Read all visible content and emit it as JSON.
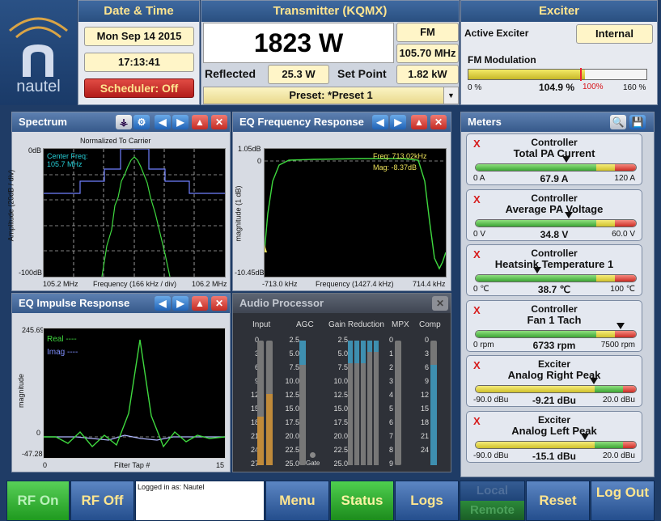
{
  "branding": {
    "logo_text": "nautel"
  },
  "datetime": {
    "title": "Date & Time",
    "date": "Mon Sep 14 2015",
    "time": "17:13:41",
    "scheduler": "Scheduler: Off"
  },
  "transmitter": {
    "title": "Transmitter (KQMX)",
    "power": "1823 W",
    "mode": "FM",
    "frequency": "105.70 MHz",
    "reflected_label": "Reflected",
    "reflected_value": "25.3 W",
    "setpoint_label": "Set Point",
    "setpoint_value": "1.82 kW",
    "preset": "Preset: *Preset 1"
  },
  "exciter": {
    "title": "Exciter",
    "active_label": "Active Exciter",
    "active_value": "Internal",
    "mod_label": "FM Modulation",
    "mod_min": "0 %",
    "mod_value": "104.9 %",
    "mod_100": "100%",
    "mod_max": "160 %",
    "mod_fraction": 0.656
  },
  "spectrum": {
    "title": "Spectrum",
    "subtitle": "Normalized To Carrier",
    "ytop": "0dB",
    "ybottom": "-100dB",
    "ylabel": "Amplitude (20dB / div)",
    "center": "Center Freq:",
    "center_value": "105.7 MHz",
    "xleft": "105.2 MHz",
    "xmid": "Frequency (166 kHz / div)",
    "xright": "106.2 MHz"
  },
  "eq_freq": {
    "title": "EQ Frequency Response",
    "ytop": "1.05dB",
    "yzero": "0",
    "ybottom": "-10.45dB",
    "ylabel": "magnitude (1 dB)",
    "freq": "Freq: 713.02kHz",
    "mag": "Mag: -8.37dB",
    "xleft": "-713.0 kHz",
    "xmid": "Frequency (1427.4 kHz)",
    "xright": "714.4 kHz"
  },
  "eq_impulse": {
    "title": "EQ Impulse Response",
    "ytop": "245.69",
    "yzero": "0",
    "ybottom": "-47.28",
    "ylabel": "magnitude",
    "legend_real": "Real ----",
    "legend_imag": "Imag ----",
    "xleft": "0",
    "xmid": "Filter Tap #",
    "xright": "15"
  },
  "audio": {
    "title": "Audio Processor",
    "input": "Input",
    "agc": "AGC",
    "gain": "Gain Reduction",
    "mpx": "MPX",
    "comp": "Comp",
    "gate": "Gate",
    "input_scale": [
      "0",
      "3",
      "6",
      "9",
      "12",
      "15",
      "18",
      "21",
      "24",
      "27"
    ],
    "agc_scale": [
      "2.5",
      "5.0",
      "7.5",
      "10.0",
      "12.5",
      "15.0",
      "17.5",
      "20.0",
      "22.5",
      "25.0"
    ],
    "gain_scale": [
      "2.5",
      "5.0",
      "7.5",
      "10.0",
      "12.5",
      "15.0",
      "17.5",
      "20.0",
      "22.5",
      "25.0"
    ],
    "mpx_scale": [
      "0",
      "1",
      "2",
      "3",
      "4",
      "5",
      "6",
      "7",
      "8",
      "9"
    ],
    "comp_scale": [
      "0",
      "3",
      "6",
      "9",
      "12",
      "15",
      "18",
      "21",
      "24"
    ]
  },
  "meters": {
    "title": "Meters",
    "items": [
      {
        "group": "Controller",
        "name": "Total PA Current",
        "min": "0 A",
        "value": "67.9 A",
        "max": "120 A",
        "fraction": 0.566
      },
      {
        "group": "Controller",
        "name": "Average PA Voltage",
        "min": "0 V",
        "value": "34.8 V",
        "max": "60.0 V",
        "fraction": 0.58
      },
      {
        "group": "Controller",
        "name": "Heatsink Temperature 1",
        "min": "0 ℃",
        "value": "38.7 ℃",
        "max": "100 ℃",
        "fraction": 0.387
      },
      {
        "group": "Controller",
        "name": "Fan 1 Tach",
        "min": "0 rpm",
        "value": "6733 rpm",
        "max": "7500 rpm",
        "fraction": 0.898
      },
      {
        "group": "Exciter",
        "name": "Analog Right Peak",
        "min": "-90.0 dBu",
        "value": "-9.21 dBu",
        "max": "20.0 dBu",
        "fraction": 0.734
      },
      {
        "group": "Exciter",
        "name": "Analog Left Peak",
        "min": "-90.0 dBu",
        "value": "-15.1 dBu",
        "max": "20.0 dBu",
        "fraction": 0.681
      }
    ]
  },
  "footer": {
    "rf_on": "RF On",
    "rf_off": "RF Off",
    "login": "Logged in as: Nautel",
    "menu": "Menu",
    "status": "Status",
    "logs": "Logs",
    "local": "Local",
    "remote": "Remote",
    "reset": "Reset",
    "logout": "Log Out"
  }
}
